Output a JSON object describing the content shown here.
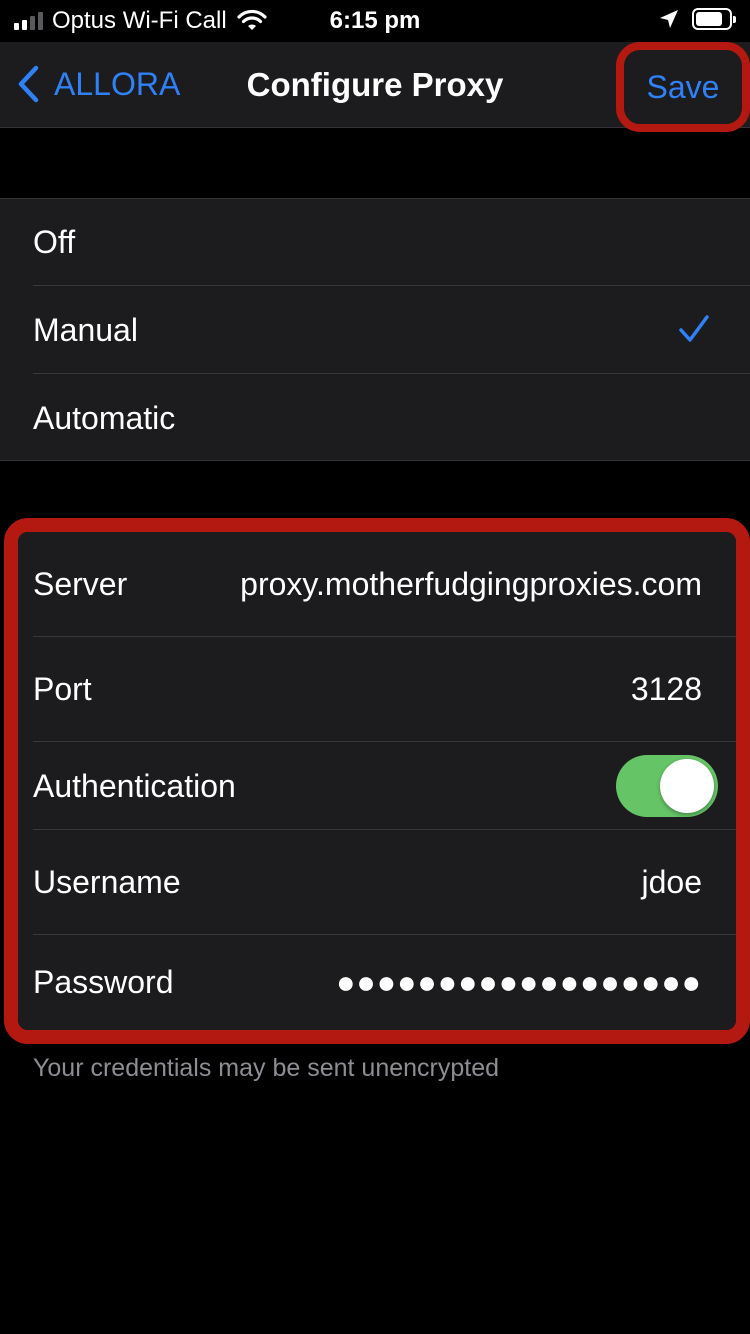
{
  "status_bar": {
    "carrier": "Optus Wi-Fi Call",
    "time": "6:15 pm",
    "signal_bars": 2,
    "signal_bars_total": 4,
    "battery_level": 0.8,
    "icons": [
      "signal-icon",
      "wifi-icon",
      "location-arrow-icon",
      "battery-icon"
    ]
  },
  "nav": {
    "back_label": "ALLORA",
    "title": "Configure Proxy",
    "save_label": "Save"
  },
  "proxy_modes": {
    "items": [
      {
        "label": "Off",
        "selected": false
      },
      {
        "label": "Manual",
        "selected": true
      },
      {
        "label": "Automatic",
        "selected": false
      }
    ]
  },
  "settings": {
    "server": {
      "label": "Server",
      "value": "proxy.motherfudgingproxies.com"
    },
    "port": {
      "label": "Port",
      "value": "3128"
    },
    "authentication": {
      "label": "Authentication",
      "enabled": true
    },
    "username": {
      "label": "Username",
      "value": "jdoe"
    },
    "password": {
      "label": "Password",
      "value": "●●●●●●●●●●●●●●●●●●"
    }
  },
  "footer_note": "Your credentials may be sent unencrypted",
  "colors": {
    "accent": "#2f81f7",
    "toggle_on": "#65c466",
    "highlight_outline": "#b31910",
    "group_background": "#1c1c1e",
    "secondary_text": "#8d8d93"
  }
}
